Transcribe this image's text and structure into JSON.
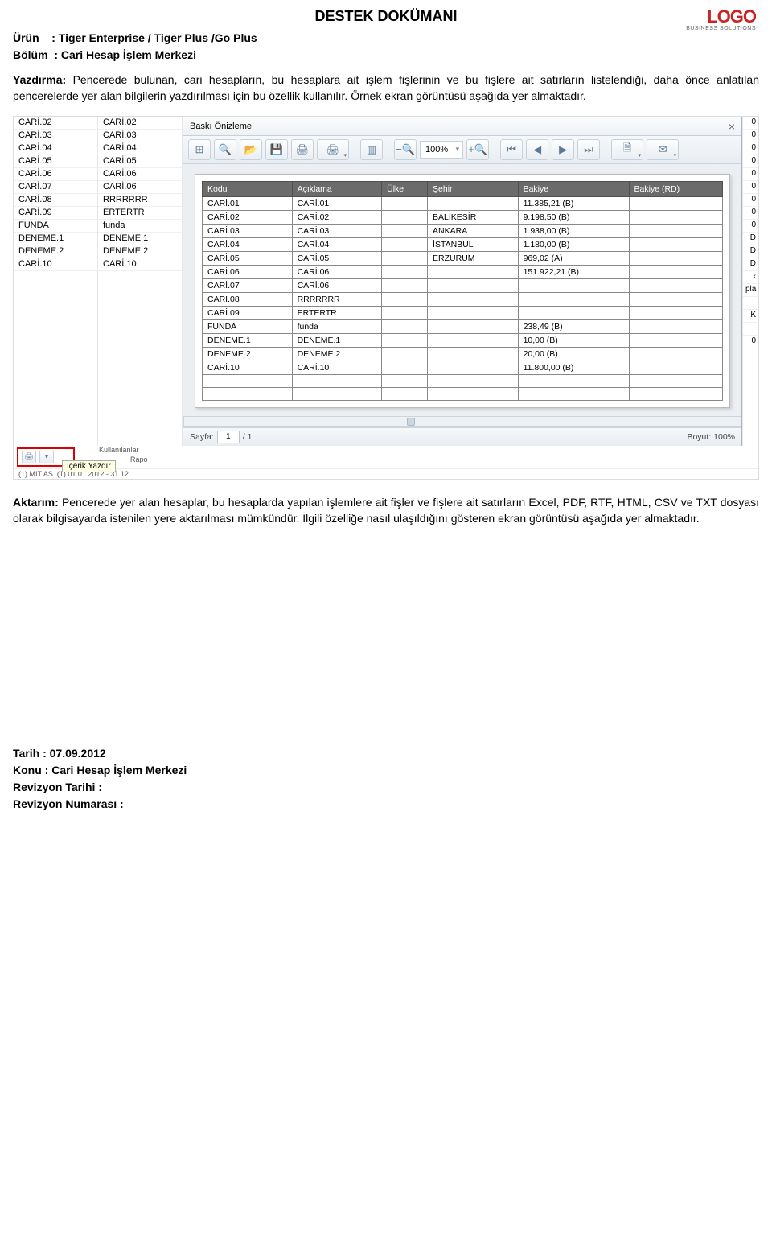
{
  "doc": {
    "headerTitle": "DESTEK DOKÜMANI",
    "logo": {
      "main": "LOGO",
      "sub": "BUSINESS SOLUTIONS"
    },
    "metaProductLabel": "Ürün",
    "metaProductValue": ": Tiger Enterprise / Tiger Plus /Go Plus",
    "metaSectionLabel": "Bölüm",
    "metaSectionValue": ": Cari Hesap İşlem Merkezi",
    "para1Head": "Yazdırma:",
    "para1Body": " Pencerede bulunan, cari hesapların, bu hesaplara ait işlem fişlerinin ve bu fişlere ait satırların listelendiği, daha önce anlatılan pencerelerde yer alan bilgilerin yazdırılması için bu özellik kullanılır. Örnek ekran görüntüsü aşağıda yer almaktadır.",
    "para2Head": "Aktarım:",
    "para2Body": " Pencerede yer alan hesaplar, bu hesaplarda yapılan işlemlere ait fişler ve fişlere ait satırların Excel, PDF, RTF, HTML, CSV ve TXT dosyası olarak bilgisayarda istenilen yere aktarılması mümkündür. İlgili özelliğe nasıl ulaşıldığını gösteren ekran görüntüsü aşağıda yer almaktadır.",
    "footer": {
      "l1": "Tarih : 07.09.2012",
      "l2": "Konu : Cari Hesap İşlem Merkezi",
      "l3": "Revizyon Tarihi :",
      "l4": "Revizyon Numarası :"
    }
  },
  "screenshot": {
    "previewTitle": "Baskı Önizleme",
    "zoom": "100%",
    "statusPageLabel": "Sayfa:",
    "statusPageCur": "1",
    "statusPageTotal": "/ 1",
    "statusSizeLabel": "Boyut: 100%",
    "tooltip": "İçerik Yazdır",
    "redbox_text": "Kullanılanlar",
    "bottomExtra": "(1) MIT AS.    (1) 01.01.2012 - 31.12",
    "bottomExtra2": "Rapo",
    "outerLeftCol": [
      "CARİ.02",
      "CARİ.03",
      "CARİ.04",
      "CARİ.05",
      "CARİ.06",
      "CARİ.07",
      "CARİ.08",
      "CARİ.09",
      "FUNDA",
      "DENEME.1",
      "DENEME.2",
      "CARİ.10"
    ],
    "outerLeftCol2": [
      "CARİ.02",
      "CARİ.03",
      "CARİ.04",
      "CARİ.05",
      "CARİ.06",
      "CARİ.06",
      "RRRRRRR",
      "ERTERTR",
      "funda",
      "DENEME.1",
      "DENEME.2",
      "CARİ.10"
    ],
    "outerRightBadges": [
      "0",
      "0",
      "0",
      "0",
      "0",
      "0",
      "0",
      "0",
      "0",
      "D",
      "D",
      "D"
    ],
    "outerRightBottom": [
      "‹",
      "pla",
      "",
      "K",
      "",
      "0"
    ],
    "tableHeaders": [
      "Kodu",
      "Açıklama",
      "Ülke",
      "Şehir",
      "Bakiye",
      "Bakiye (RD)"
    ],
    "tableRows": [
      [
        "CARİ.01",
        "CARİ.01",
        "",
        "",
        "11.385,21 (B)",
        ""
      ],
      [
        "CARİ.02",
        "CARİ.02",
        "",
        "BALIKESİR",
        "9.198,50 (B)",
        ""
      ],
      [
        "CARİ.03",
        "CARİ.03",
        "",
        "ANKARA",
        "1.938,00 (B)",
        ""
      ],
      [
        "CARİ.04",
        "CARİ.04",
        "",
        "İSTANBUL",
        "1.180,00 (B)",
        ""
      ],
      [
        "CARİ.05",
        "CARİ.05",
        "",
        "ERZURUM",
        "969,02 (A)",
        ""
      ],
      [
        "CARİ.06",
        "CARİ.06",
        "",
        "",
        "151.922,21 (B)",
        ""
      ],
      [
        "CARİ.07",
        "CARİ.06",
        "",
        "",
        "",
        ""
      ],
      [
        "CARİ.08",
        "RRRRRRR",
        "",
        "",
        "",
        ""
      ],
      [
        "CARİ.09",
        "ERTERTR",
        "",
        "",
        "",
        ""
      ],
      [
        "FUNDA",
        "funda",
        "",
        "",
        "238,49 (B)",
        ""
      ],
      [
        "DENEME.1",
        "DENEME.1",
        "",
        "",
        "10,00 (B)",
        ""
      ],
      [
        "DENEME.2",
        "DENEME.2",
        "",
        "",
        "20,00 (B)",
        ""
      ],
      [
        "CARİ.10",
        "CARİ.10",
        "",
        "",
        "11.800,00 (B)",
        ""
      ],
      [
        "",
        "",
        "",
        "",
        "",
        ""
      ],
      [
        "",
        "",
        "",
        "",
        "",
        ""
      ]
    ]
  }
}
